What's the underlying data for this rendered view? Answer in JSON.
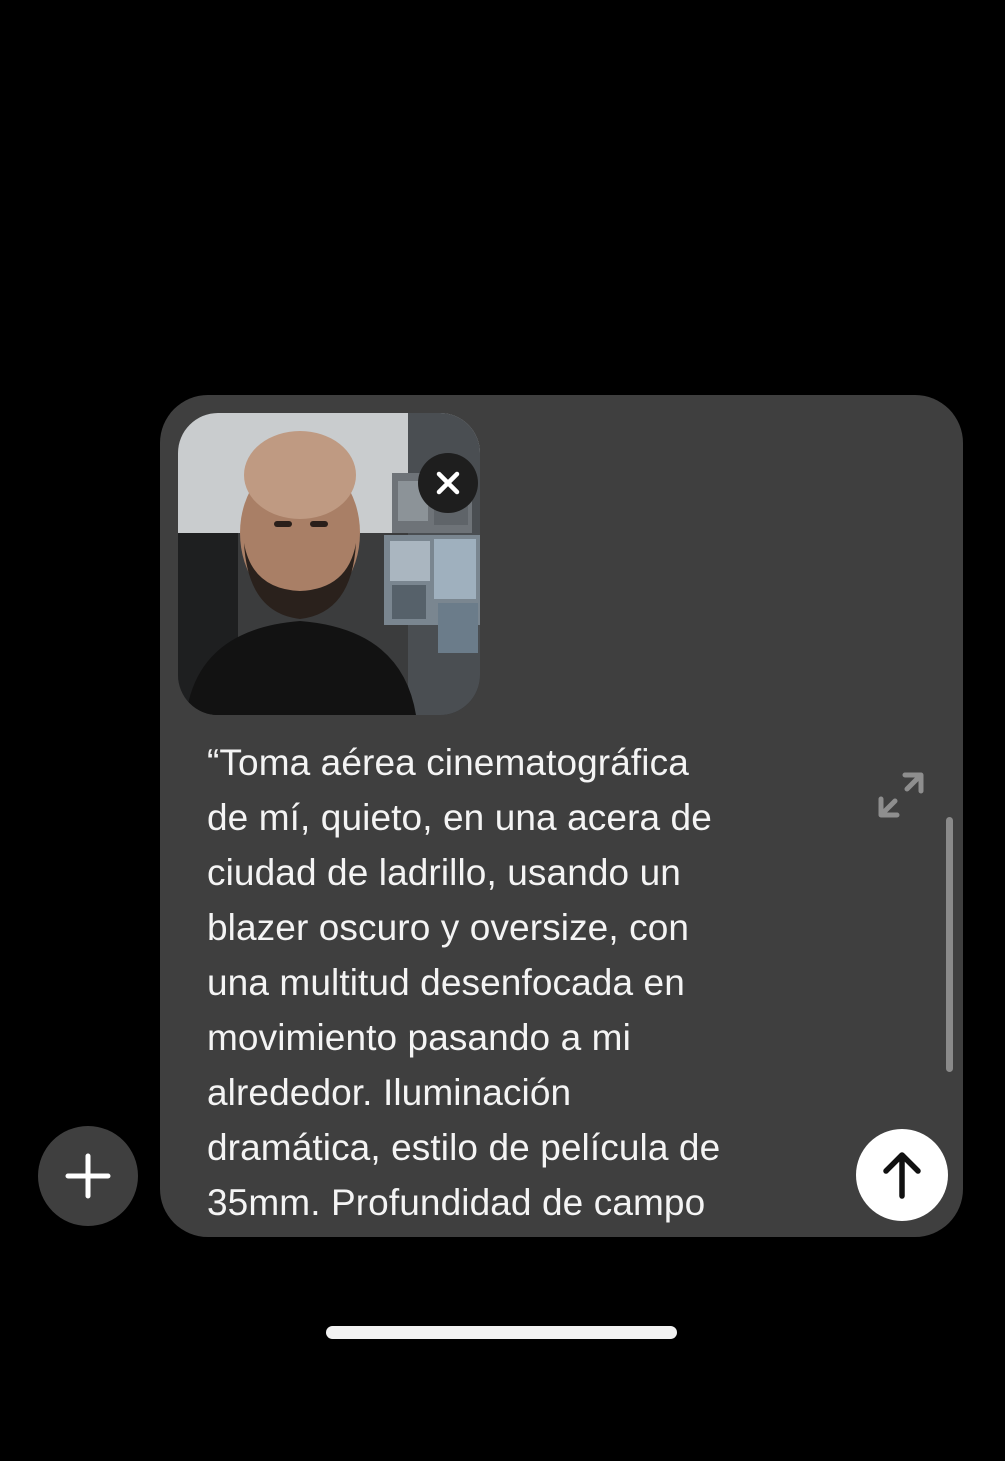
{
  "composer": {
    "prompt_text": "“Toma aérea cinematográfica\nde mí, quieto, en una acera de\nciudad de ladrillo, usando un\nblazer oscuro y oversize, con\nuna multitud desenfocada en\nmovimiento pasando a mi\nalrededor. Iluminación\ndramática, estilo de película de\n35mm. Profundidad de campo",
    "attachment_icon": "photo-thumbnail",
    "remove_icon": "close-icon",
    "expand_icon": "expand-icon",
    "send_icon": "arrow-up-icon"
  },
  "toolbar": {
    "add_icon": "plus-icon"
  },
  "colors": {
    "background": "#000000",
    "composer_bg": "#3f3f3f",
    "text": "#f4f4f4",
    "send_button": "#ffffff"
  }
}
